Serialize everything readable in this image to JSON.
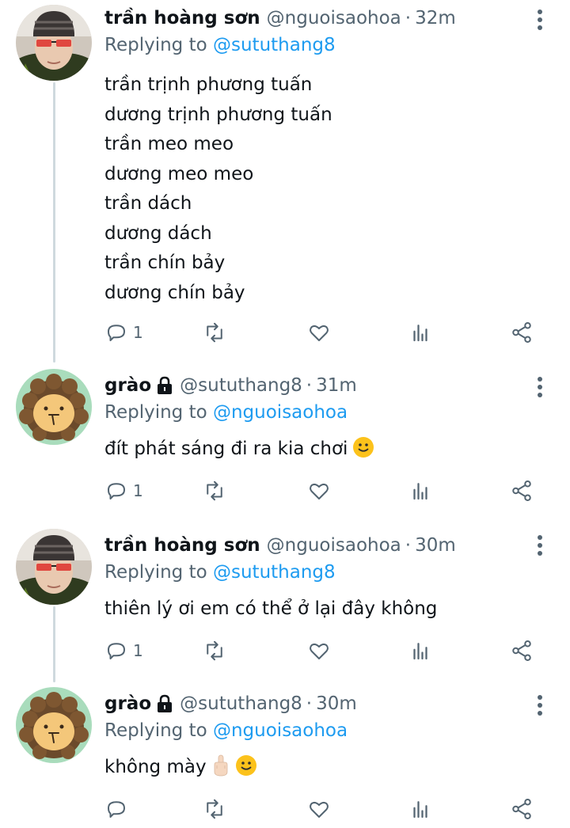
{
  "tweets": [
    {
      "name": "trần hoàng sơn",
      "handle": "@nguoisaohoa",
      "time": "32m",
      "replying_prefix": "Replying to",
      "replying_to": "@sututhang8",
      "lines": [
        "trần trịnh phương tuấn",
        "dương trịnh phương tuấn",
        "trần meo meo",
        "dương meo meo",
        "trần dách",
        "dương dách",
        "trần chín bảy",
        "dương chín bảy"
      ],
      "reply_count": "1",
      "locked": false,
      "avatar": "person-with-red-glasses"
    },
    {
      "name": "grào",
      "handle": "@sututhang8",
      "time": "31m",
      "replying_prefix": "Replying to",
      "replying_to": "@nguoisaohoa",
      "lines": [
        "đít phát sáng đi ra kia chơi"
      ],
      "emoji": [
        "slightly-smiling-face"
      ],
      "reply_count": "1",
      "locked": true,
      "avatar": "cartoon-lion"
    },
    {
      "name": "trần hoàng sơn",
      "handle": "@nguoisaohoa",
      "time": "30m",
      "replying_prefix": "Replying to",
      "replying_to": "@sututhang8",
      "lines": [
        "thiên lý ơi em có thể ở lại đây không"
      ],
      "reply_count": "1",
      "locked": false,
      "avatar": "person-with-red-glasses"
    },
    {
      "name": "grào",
      "handle": "@sututhang8",
      "time": "30m",
      "replying_prefix": "Replying to",
      "replying_to": "@nguoisaohoa",
      "lines": [
        "không mày"
      ],
      "emoji": [
        "middle-finger",
        "slightly-smiling-face"
      ],
      "reply_count": "",
      "locked": true,
      "avatar": "cartoon-lion"
    }
  ],
  "colors": {
    "text": "#0f1419",
    "muted": "#536471",
    "link": "#1d9bf0",
    "thread_line": "#cfd9de"
  },
  "icons": {
    "reply": "reply-icon",
    "retweet": "retweet-icon",
    "like": "heart-icon",
    "views": "analytics-icon",
    "share": "share-icon",
    "more": "more-vertical-icon",
    "lock": "lock-icon"
  }
}
